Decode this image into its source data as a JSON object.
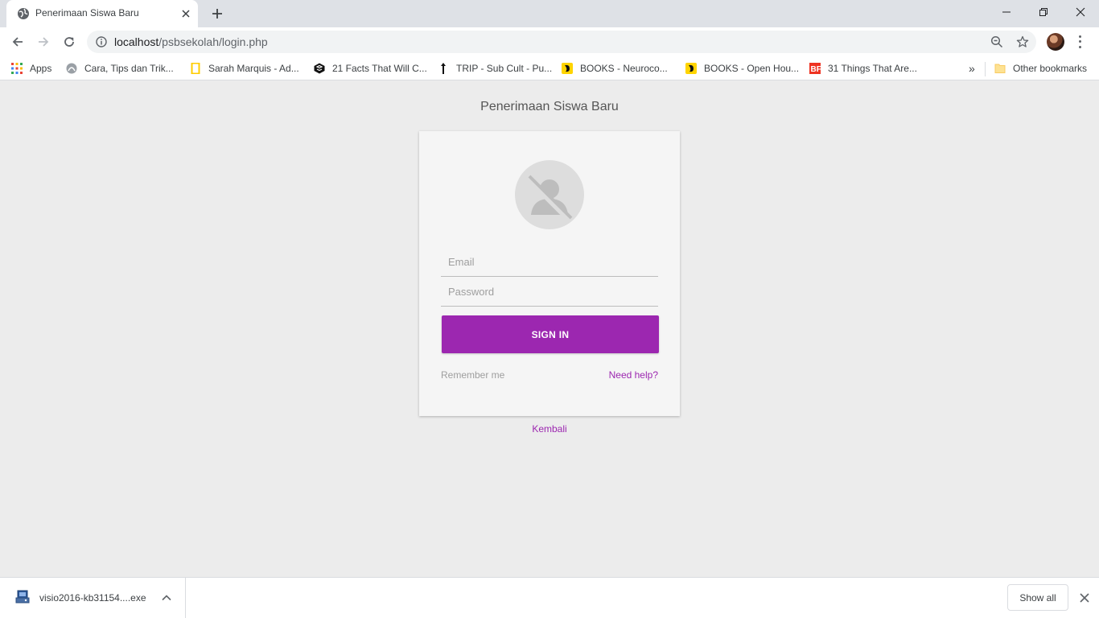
{
  "browser": {
    "tab": {
      "title": "Penerimaan Siswa Baru",
      "favicon": "globe-icon"
    },
    "address": {
      "host": "localhost",
      "path": "/psbsekolah/login.php"
    },
    "bookmarks": [
      {
        "label": "Apps",
        "icon": "apps-grid-icon"
      },
      {
        "label": "Cara, Tips dan Trik...",
        "icon": "site-icon"
      },
      {
        "label": "Sarah Marquis - Ad...",
        "icon": "natgeo-icon"
      },
      {
        "label": "21 Facts That Will C...",
        "icon": "site-icon"
      },
      {
        "label": "TRIP - Sub Cult - Pu...",
        "icon": "site-icon"
      },
      {
        "label": "BOOKS - Neuroco...",
        "icon": "site-icon"
      },
      {
        "label": "BOOKS - Open Hou...",
        "icon": "site-icon"
      },
      {
        "label": "31 Things That Are...",
        "icon": "bf-icon"
      }
    ],
    "bookmarks_more": "»",
    "other_bookmarks": "Other bookmarks"
  },
  "page": {
    "title": "Penerimaan Siswa Baru",
    "form": {
      "email_placeholder": "Email",
      "password_placeholder": "Password",
      "signin_label": "SIGN IN",
      "remember_label": "Remember me",
      "help_label": "Need help?"
    },
    "back_link": "Kembali"
  },
  "download_shelf": {
    "file_name": "visio2016-kb31154....exe",
    "show_all_label": "Show all"
  },
  "colors": {
    "accent": "#9c27b0",
    "page_bg": "#ececec",
    "card_bg": "#f5f5f5"
  }
}
